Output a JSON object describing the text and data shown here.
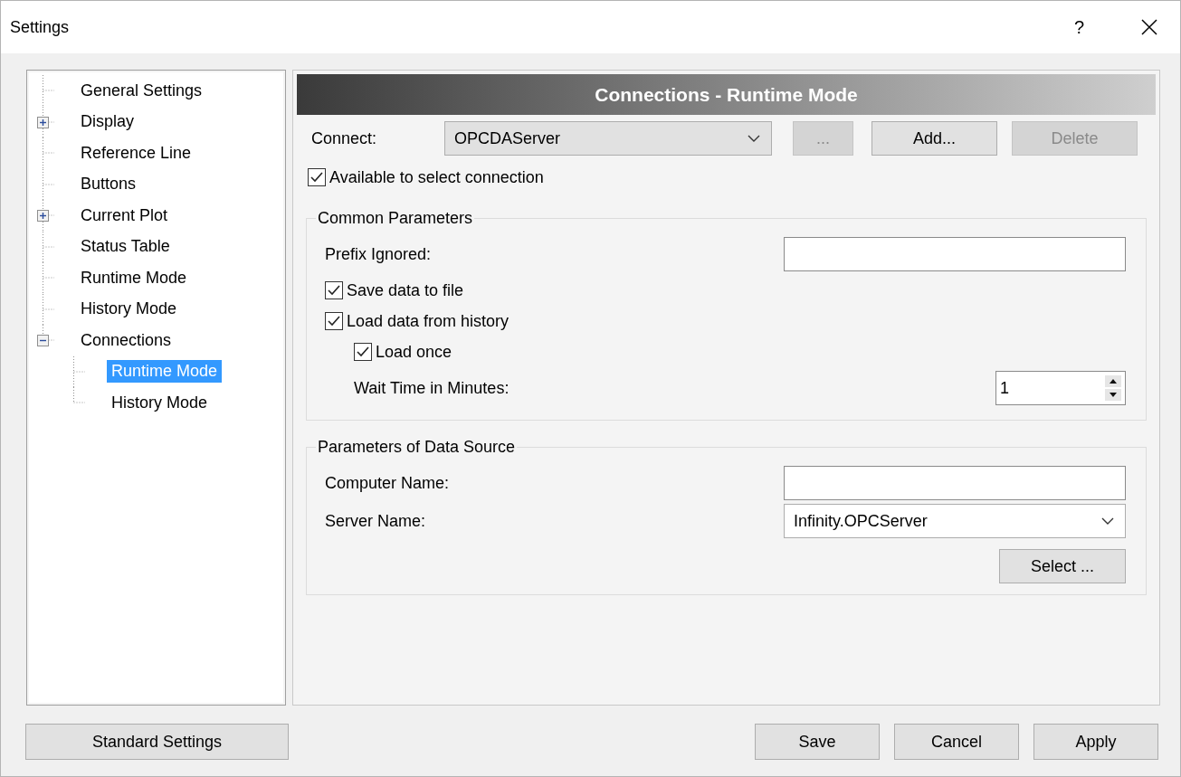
{
  "window": {
    "title": "Settings",
    "help": "?"
  },
  "tree": [
    {
      "label": "General Settings",
      "kind": "leaf",
      "selected": false
    },
    {
      "label": "Display",
      "kind": "folder",
      "expanded": false,
      "selected": false
    },
    {
      "label": "Reference Line",
      "kind": "leaf",
      "selected": false
    },
    {
      "label": "Buttons",
      "kind": "leaf",
      "selected": false
    },
    {
      "label": "Current Plot",
      "kind": "folder",
      "expanded": false,
      "selected": false
    },
    {
      "label": "Status Table",
      "kind": "leaf",
      "selected": false
    },
    {
      "label": "Runtime Mode",
      "kind": "leaf",
      "selected": false
    },
    {
      "label": "History Mode",
      "kind": "leaf",
      "selected": false
    },
    {
      "label": "Connections",
      "kind": "folder",
      "expanded": true,
      "selected": false,
      "children": [
        {
          "label": "Runtime Mode",
          "kind": "leaf",
          "selected": true
        },
        {
          "label": "History Mode",
          "kind": "leaf",
          "selected": false
        }
      ]
    }
  ],
  "panel": {
    "header": "Connections - Runtime Mode",
    "connect": {
      "label": "Connect:",
      "value": "OPCDAServer"
    },
    "connect_buttons": [
      {
        "label": "...",
        "disabled": true
      },
      {
        "label": "Add...",
        "disabled": false
      },
      {
        "label": "Delete",
        "disabled": true
      }
    ],
    "available": {
      "label": "Available to select connection",
      "checked": true
    },
    "groups": [
      {
        "title": "Common Parameters",
        "rows": [
          {
            "kind": "field",
            "label": "Prefix Ignored:"
          },
          {
            "kind": "check",
            "label": "Save data to file",
            "checked": true
          },
          {
            "kind": "check",
            "label": "Load data from history",
            "checked": true,
            "children": [
              {
                "kind": "check",
                "label": "Load once",
                "checked": true
              },
              {
                "kind": "spin",
                "label": "Wait Time in Minutes:",
                "value": "1"
              }
            ]
          }
        ]
      },
      {
        "title": "Parameters of Data Source",
        "rows": [
          {
            "kind": "field",
            "label": "Computer Name:"
          },
          {
            "kind": "dropdown",
            "label": "Server Name:",
            "value": "Infinity.OPCServer"
          },
          {
            "kind": "button",
            "label": "Select ..."
          }
        ]
      }
    ]
  },
  "footer": {
    "left_buttons": [
      "Standard Settings"
    ],
    "right_buttons": [
      "Save",
      "Cancel",
      "Apply"
    ]
  }
}
